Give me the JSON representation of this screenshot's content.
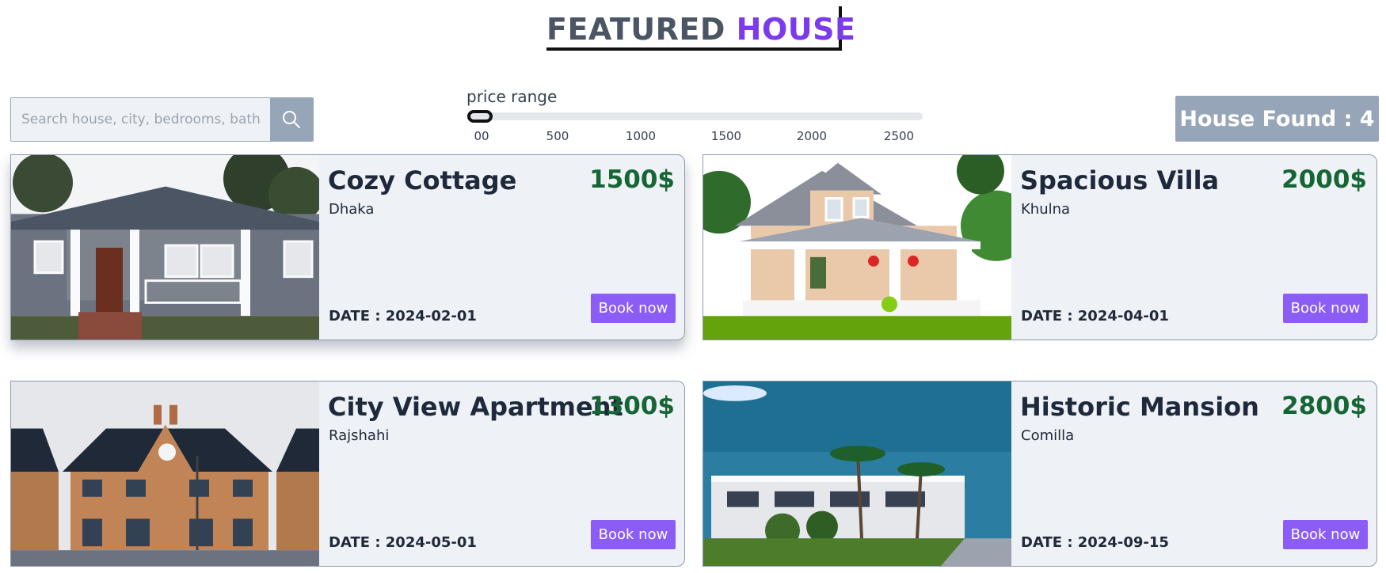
{
  "header": {
    "title_part1": "FEATURED",
    "title_part2": "HOUSE"
  },
  "search": {
    "placeholder": "Search house, city, bedrooms, bathrooms",
    "value": "",
    "icon": "search-icon"
  },
  "price_range": {
    "label": "price range",
    "ticks": [
      "00",
      "500",
      "1000",
      "1500",
      "2000",
      "2500"
    ],
    "min_value": 0
  },
  "house_found_label": "House Found : 4",
  "houses": [
    {
      "name": "Cozy Cottage",
      "price": "1500$",
      "city": "Dhaka",
      "date": "DATE : 2024-02-01",
      "button": "Book now"
    },
    {
      "name": "Spacious Villa",
      "price": "2000$",
      "city": "Khulna",
      "date": "DATE : 2024-04-01",
      "button": "Book now"
    },
    {
      "name": "City View Apartment",
      "price": "1300$",
      "city": "Rajshahi",
      "date": "DATE : 2024-05-01",
      "button": "Book now"
    },
    {
      "name": "Historic Mansion",
      "price": "2800$",
      "city": "Comilla",
      "date": "DATE : 2024-09-15",
      "button": "Book now"
    }
  ],
  "colors": {
    "accent": "#7c3aed",
    "button": "#8b5cf6",
    "price": "#166534",
    "card_bg": "#eef2f7",
    "slate": "#97a5b8"
  }
}
